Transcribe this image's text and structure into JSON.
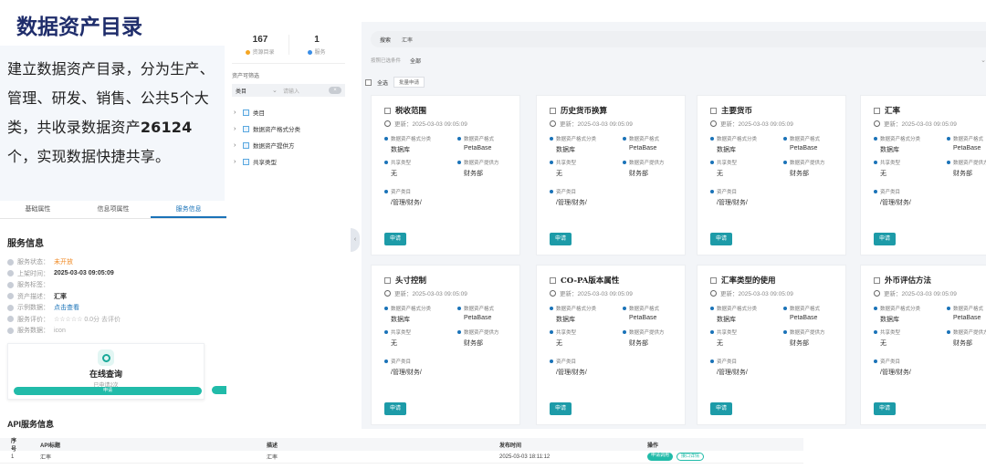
{
  "slide": {
    "title": "数据资产目录",
    "desc_part1": "建立数据资产目录，分为生产、管理、研发、销售、公共5个大类，共收录数据资产",
    "desc_count": "26124",
    "desc_part2": "个，实现数据快捷共享。"
  },
  "service": {
    "tabs": [
      "基础属性",
      "信息项属性",
      "服务信息"
    ],
    "heading": "服务信息",
    "rows": [
      {
        "label": "服务状态：",
        "value": "未开放",
        "tone": "orange"
      },
      {
        "label": "上架时间：",
        "value": "2025-03-03 09:05:09",
        "tone": "bold"
      },
      {
        "label": "服务标签：",
        "value": "",
        "tone": "bold"
      },
      {
        "label": "资产描述：",
        "value": "汇率",
        "tone": "bold"
      },
      {
        "label": "示例数据：",
        "value": "点击查看",
        "tone": "blue"
      },
      {
        "label": "服务评价：",
        "value": "☆☆☆☆☆ 0.0分  去评价",
        "tone": "muted"
      },
      {
        "label": "服务数据：",
        "value": "icon",
        "tone": "muted"
      }
    ],
    "query_card": {
      "title": "在线查询",
      "subtitle": "已申请2次",
      "button": "申请"
    }
  },
  "api": {
    "title": "API服务信息",
    "columns": [
      "序号",
      "API标题",
      "描述",
      "发布时间",
      "操作"
    ],
    "rows": [
      {
        "index": "1",
        "title": "汇率",
        "desc": "汇率",
        "time": "2025-03-03 18:11:12",
        "action1": "申请调用",
        "action2": "接口详情"
      }
    ]
  },
  "filter": {
    "stats": [
      {
        "num": "167",
        "label": "资源目录",
        "color": "#f5a623"
      },
      {
        "num": "1",
        "label": "服务",
        "color": "#3a8ee6"
      }
    ],
    "section_label": "资产可筛选",
    "select_value": "类目",
    "input_placeholder": "请输入",
    "tree": [
      "类目",
      "数据资产格式分类",
      "数据资产提供方",
      "共享类型"
    ]
  },
  "main": {
    "search_button": "搜索",
    "search_value": "汇率",
    "cond_label": "按照已选条件",
    "cond_value": "全部",
    "select_all": "全选",
    "bulk_apply": "批量申请",
    "field_labels": {
      "format_class": "数据资产格式分类",
      "format": "数据资产格式",
      "share_type": "共享类型",
      "provider": "数据资产提供方",
      "category": "资产类目"
    },
    "apply_label": "申请",
    "cards": [
      {
        "title": "税收范围",
        "time": "更新：2025-03-03 09:05:09",
        "format_class": "数据库",
        "format": "PetaBase",
        "share_type": "无",
        "provider": "财务部",
        "category": "/管理/财务/"
      },
      {
        "title": "历史货币换算",
        "time": "更新：2025-03-03 09:05:09",
        "format_class": "数据库",
        "format": "PetaBase",
        "share_type": "无",
        "provider": "财务部",
        "category": "/管理/财务/"
      },
      {
        "title": "主要货币",
        "time": "更新：2025-03-03 09:05:09",
        "format_class": "数据库",
        "format": "PetaBase",
        "share_type": "无",
        "provider": "财务部",
        "category": "/管理/财务/"
      },
      {
        "title": "汇率",
        "time": "更新：2025-03-03 09:05:09",
        "format_class": "数据库",
        "format": "PetaBase",
        "share_type": "无",
        "provider": "财务部",
        "category": "/管理/财务/"
      },
      {
        "title": "头寸控制",
        "time": "更新：2025-03-03 09:05:09",
        "format_class": "数据库",
        "format": "PetaBase",
        "share_type": "无",
        "provider": "财务部",
        "category": "/管理/财务/"
      },
      {
        "title": "CO-PA版本属性",
        "time": "更新：2025-03-03 09:05:09",
        "format_class": "数据库",
        "format": "PetaBase",
        "share_type": "无",
        "provider": "财务部",
        "category": "/管理/财务/"
      },
      {
        "title": "汇率类型的使用",
        "time": "更新：2025-03-03 09:05:09",
        "format_class": "数据库",
        "format": "PetaBase",
        "share_type": "无",
        "provider": "财务部",
        "category": "/管理/财务/"
      },
      {
        "title": "外币评估方法",
        "time": "更新：2025-03-03 09:05:09",
        "format_class": "数据库",
        "format": "PetaBase",
        "share_type": "无",
        "provider": "财务部",
        "category": "/管理/财务/"
      }
    ]
  },
  "colors": {
    "title": "#1f2d6b",
    "accent": "#1d9ba8",
    "teal": "#21bba9",
    "orange": "#f08a24",
    "link": "#1a73b8"
  }
}
